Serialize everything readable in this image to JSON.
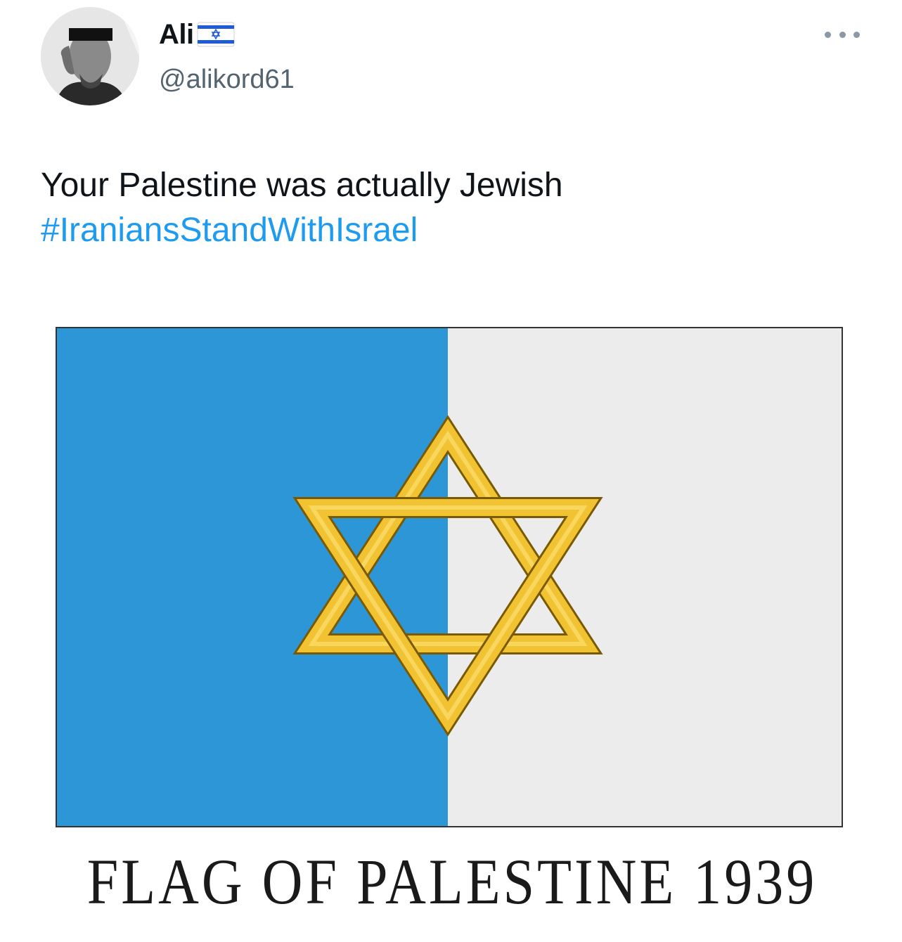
{
  "tweet": {
    "author": {
      "display_name": "Ali",
      "handle": "@alikord61",
      "badge_icon": "israel-flag-emoji-icon"
    },
    "text_line1": "Your Palestine was actually Jewish",
    "hashtag": "#IraniansStandWithIsrael",
    "more_icon": "ellipsis-icon"
  },
  "media": {
    "caption": "FLAG OF PALESTINE 1939",
    "colors": {
      "blue_stripe": "#2d96d6",
      "white_field": "#ececec",
      "star_gold": "#f1c232",
      "star_outline": "#7a5a00"
    }
  },
  "colors": {
    "text_primary": "#0f1419",
    "text_secondary": "#536471",
    "link": "#1d9bf0"
  }
}
